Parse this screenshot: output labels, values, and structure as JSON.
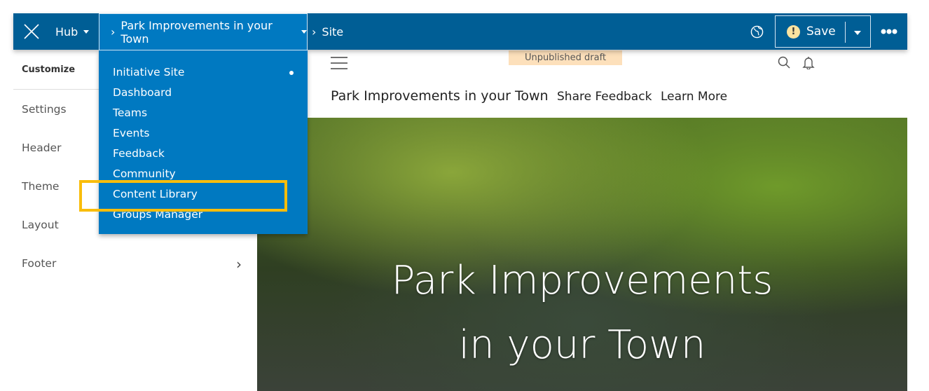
{
  "topbar": {
    "hub_label": "Hub",
    "initiative_label": "Park Improvements in your Town",
    "site_label": "Site",
    "save_label": "Save",
    "warning_glyph": "!",
    "colors": {
      "bar": "#005e95",
      "dropdown": "#0079c1",
      "highlight": "#f9bd0b"
    }
  },
  "menu": {
    "items": [
      {
        "label": "Initiative Site",
        "active": true
      },
      {
        "label": "Dashboard"
      },
      {
        "label": "Teams"
      },
      {
        "label": "Events"
      },
      {
        "label": "Feedback"
      },
      {
        "label": "Community"
      },
      {
        "label": "Content Library",
        "highlighted": true
      },
      {
        "label": "Groups Manager"
      }
    ]
  },
  "sidebar": {
    "heading": "Customize",
    "items": [
      {
        "label": "Settings"
      },
      {
        "label": "Header"
      },
      {
        "label": "Theme"
      },
      {
        "label": "Layout"
      },
      {
        "label": "Footer"
      }
    ]
  },
  "site": {
    "draft_badge": "Unpublished draft",
    "title": "Park Improvements in your Town",
    "nav": [
      "Share Feedback",
      "Learn More"
    ],
    "hero_title_line1": "Park Improvements",
    "hero_title_line2": "in your Town"
  }
}
